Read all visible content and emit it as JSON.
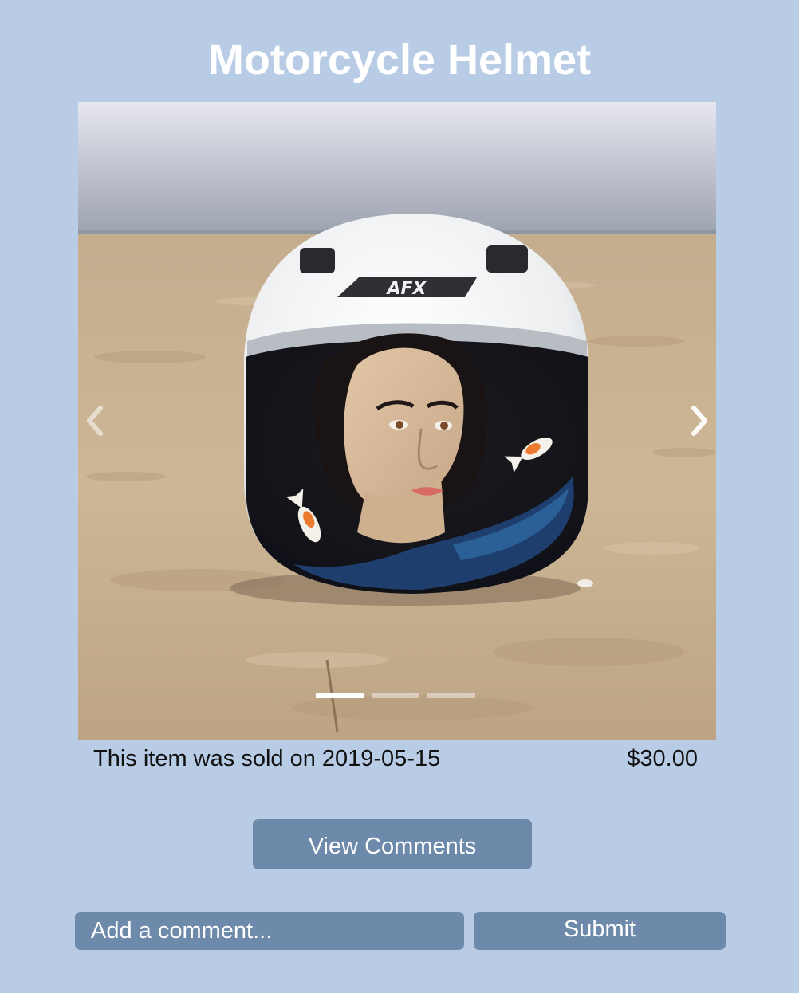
{
  "title": "Motorcycle Helmet",
  "carousel": {
    "helmet_brand": "AFX",
    "slide_count": 3,
    "active_slide": 1,
    "prev_icon": "chevron-left-icon",
    "next_icon": "chevron-right-icon"
  },
  "listing": {
    "sold_text": "This item was sold on 2019-05-15",
    "price": "$30.00"
  },
  "actions": {
    "view_comments_label": "View Comments",
    "comment_placeholder": "Add a comment...",
    "submit_label": "Submit"
  },
  "colors": {
    "background": "#b9cce6",
    "button": "#6e8aab",
    "button_text": "#ffffff"
  }
}
